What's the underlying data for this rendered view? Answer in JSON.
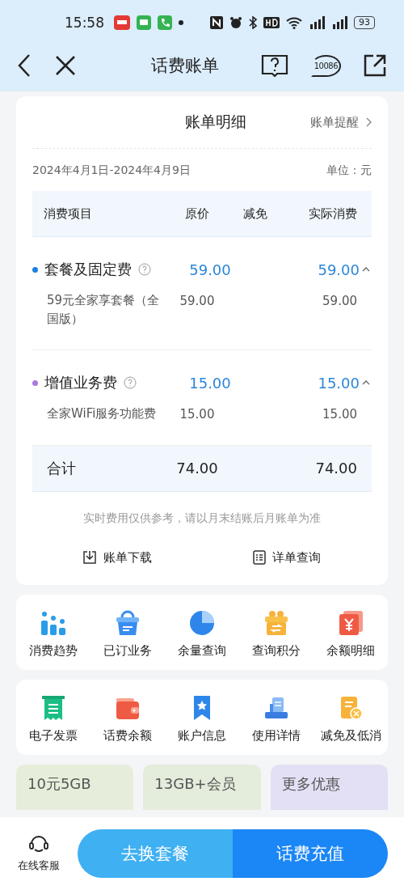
{
  "status_bar": {
    "time": "15:58",
    "battery": "93"
  },
  "nav": {
    "title": "话费账单",
    "hotline": "10086"
  },
  "bill": {
    "title": "账单明细",
    "reminder": "账单提醒",
    "period": "2024年4月1日-2024年4月9日",
    "unit": "单位：元",
    "columns": [
      "消费项目",
      "原价",
      "减免",
      "实际消费"
    ],
    "groups": [
      {
        "name": "套餐及固定费",
        "color": "#1e7fe0",
        "price": "59.00",
        "actual": "59.00",
        "expanded": true,
        "items": [
          {
            "name": "59元全家享套餐（全国版）",
            "price": "59.00",
            "actual": "59.00"
          }
        ]
      },
      {
        "name": "增值业务费",
        "color": "#a77be0",
        "price": "15.00",
        "actual": "15.00",
        "expanded": true,
        "items": [
          {
            "name": "全家WiFi服务功能费",
            "price": "15.00",
            "actual": "15.00"
          }
        ]
      }
    ],
    "total": {
      "label": "合计",
      "price": "74.00",
      "actual": "74.00"
    },
    "note": "实时费用仅供参考，请以月末结账后月账单为准",
    "actions": [
      {
        "kind": "download",
        "label": "账单下载"
      },
      {
        "kind": "detail",
        "label": "详单查询"
      }
    ]
  },
  "grids": [
    [
      {
        "kind": "trend",
        "label": "消费趋势"
      },
      {
        "kind": "basket",
        "label": "已订业务"
      },
      {
        "kind": "pie",
        "label": "余量查询"
      },
      {
        "kind": "gift",
        "label": "查询积分"
      },
      {
        "kind": "yuan",
        "label": "余额明细"
      }
    ],
    [
      {
        "kind": "invoice",
        "label": "电子发票"
      },
      {
        "kind": "wallet",
        "label": "话费余额"
      },
      {
        "kind": "bookmark",
        "label": "账户信息"
      },
      {
        "kind": "printer",
        "label": "使用详情"
      },
      {
        "kind": "coupon",
        "label": "减免及低消"
      }
    ]
  ],
  "promos": [
    {
      "title": "10元5GB",
      "color": "#e6eedb"
    },
    {
      "title": "13GB+会员",
      "color": "#e4ecdc"
    },
    {
      "title": "更多优惠",
      "color": "#e3dff5"
    }
  ],
  "bottom": {
    "service": "在线客服",
    "buttons": [
      {
        "kind": "secondary",
        "label": "去换套餐"
      },
      {
        "kind": "primary",
        "label": "话费充值"
      }
    ]
  }
}
